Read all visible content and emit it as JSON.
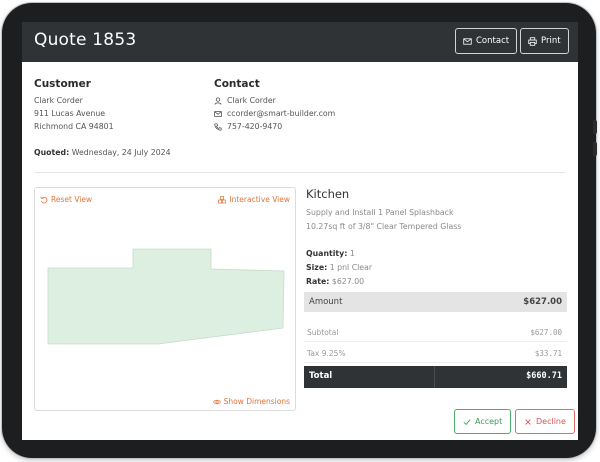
{
  "header": {
    "title": "Quote 1853",
    "contact_label": "Contact",
    "print_label": "Print"
  },
  "customer": {
    "heading": "Customer",
    "name": "Clark Corder",
    "address1": "911 Lucas Avenue",
    "address2": "Richmond CA 94801"
  },
  "contact": {
    "heading": "Contact",
    "name": "Clark Corder",
    "email": "ccorder@smart-builder.com",
    "phone": "757-420-9470"
  },
  "quoted": {
    "label": "Quoted:",
    "date": "Wednesday, 24 July 2024"
  },
  "viewer": {
    "reset_label": "Reset View",
    "interactive_label": "Interactive View",
    "dimensions_label": "Show Dimensions",
    "shape_fill": "#dcefe0"
  },
  "item": {
    "title": "Kitchen",
    "description1": "Supply and Install 1 Panel Splashback",
    "description2": "10.27sq ft of 3/8\" Clear Tempered Glass",
    "quantity_label": "Quantity:",
    "quantity": "1",
    "size_label": "Size:",
    "size": "1 pnl Clear",
    "rate_label": "Rate:",
    "rate": "$627.00"
  },
  "totals": {
    "amount_label": "Amount",
    "amount": "$627.00",
    "subtotal_label": "Subtotal",
    "subtotal": "$627.00",
    "tax_label": "Tax 9.25%",
    "tax": "$33.71",
    "total_label": "Total",
    "total": "$660.71"
  },
  "actions": {
    "accept_label": "Accept",
    "decline_label": "Decline"
  },
  "colors": {
    "header_bg": "#2f3336",
    "accent_orange": "#e0743a",
    "accept_green": "#3a9a57",
    "decline_red": "#d9534f"
  }
}
